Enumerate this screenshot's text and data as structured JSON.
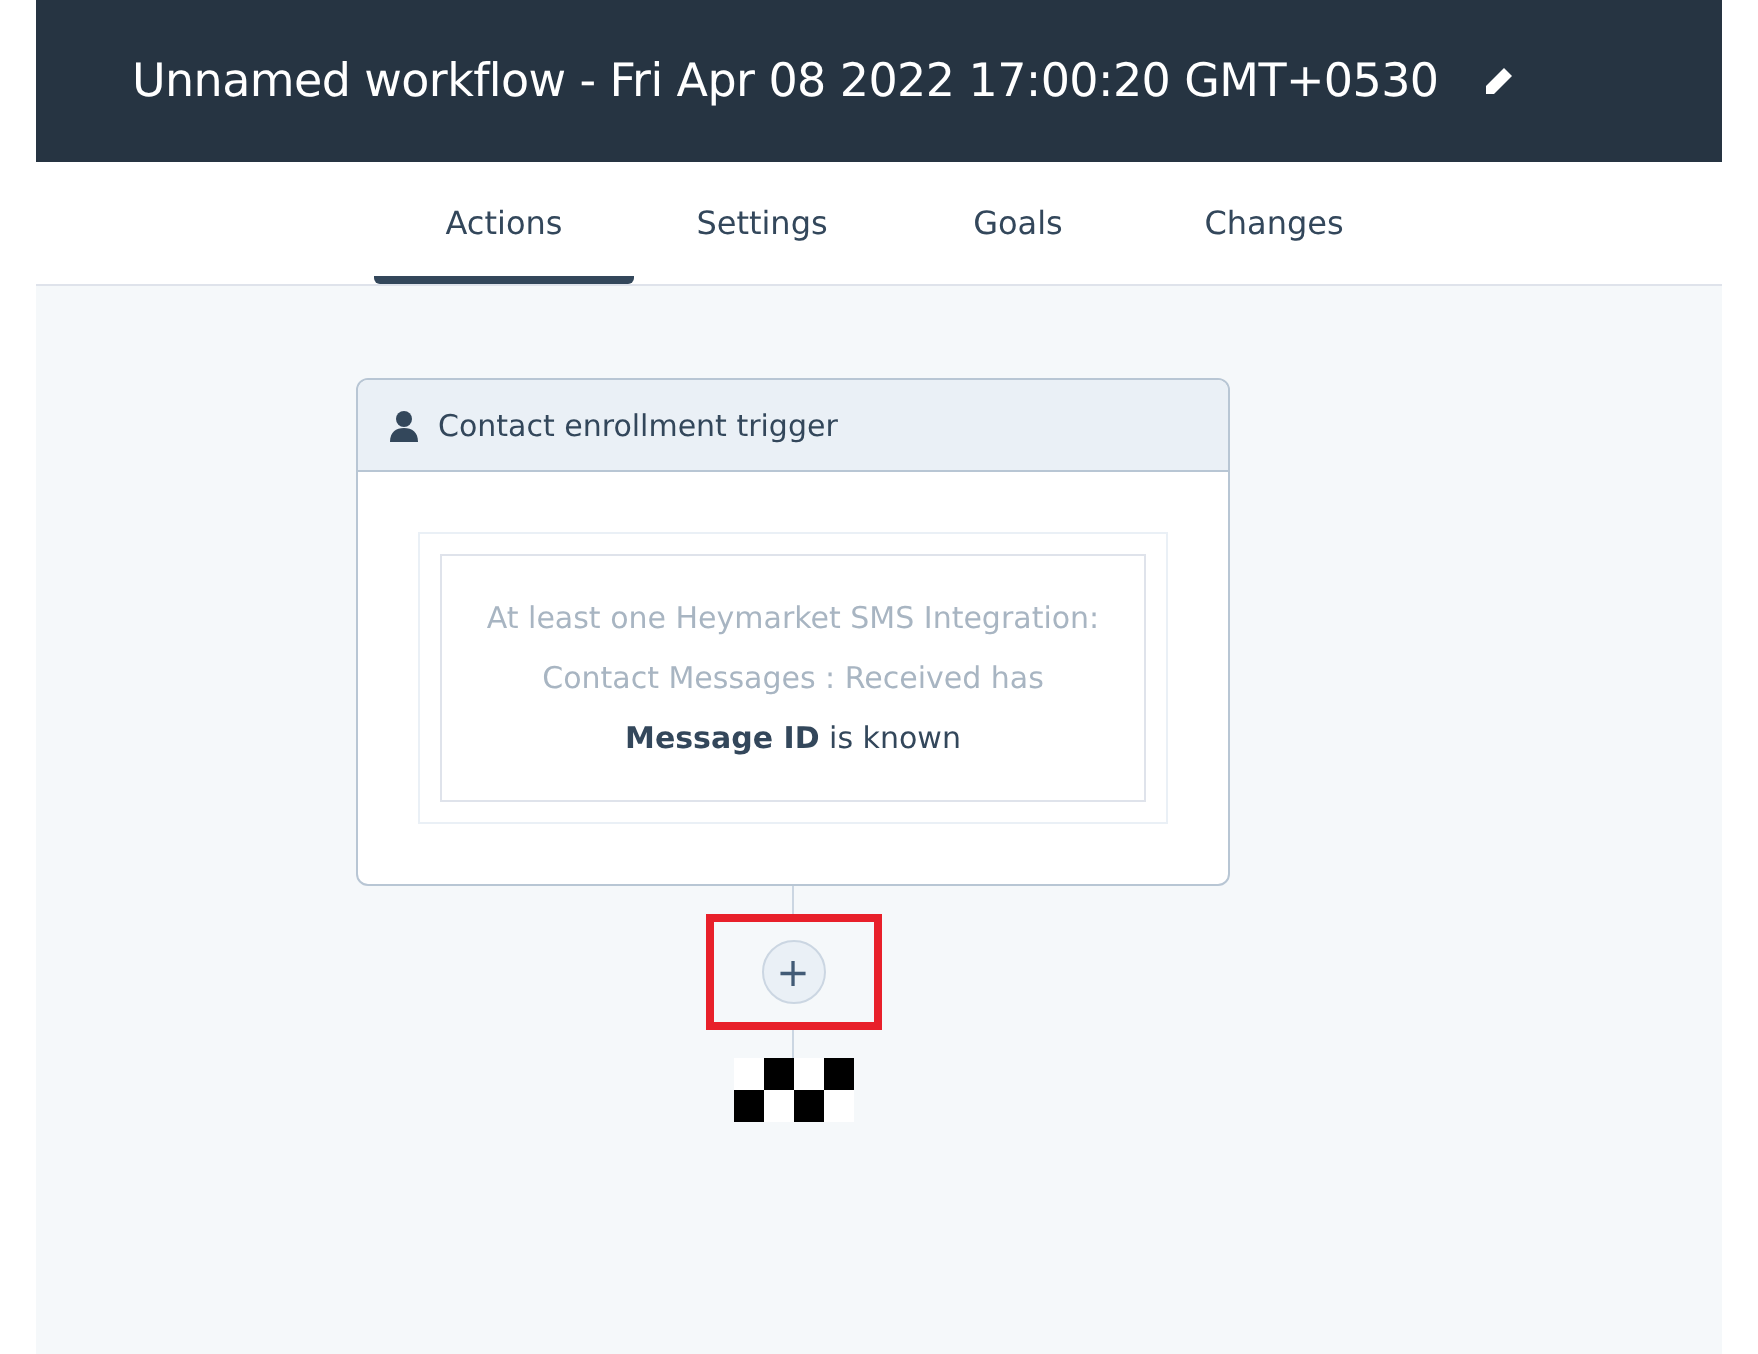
{
  "header": {
    "title": "Unnamed workflow - Fri Apr 08 2022 17:00:20 GMT+0530"
  },
  "tabs": [
    {
      "label": "Actions",
      "selected": true
    },
    {
      "label": "Settings",
      "selected": false
    },
    {
      "label": "Goals",
      "selected": false
    },
    {
      "label": "Changes",
      "selected": false
    }
  ],
  "trigger_card": {
    "title": "Contact enrollment trigger",
    "criteria": "At least one Heymarket SMS Integration: Contact Messages : Received has",
    "condition": "**Message ID** is known"
  },
  "add_action": {
    "label": "+",
    "highlighted": true
  }
}
